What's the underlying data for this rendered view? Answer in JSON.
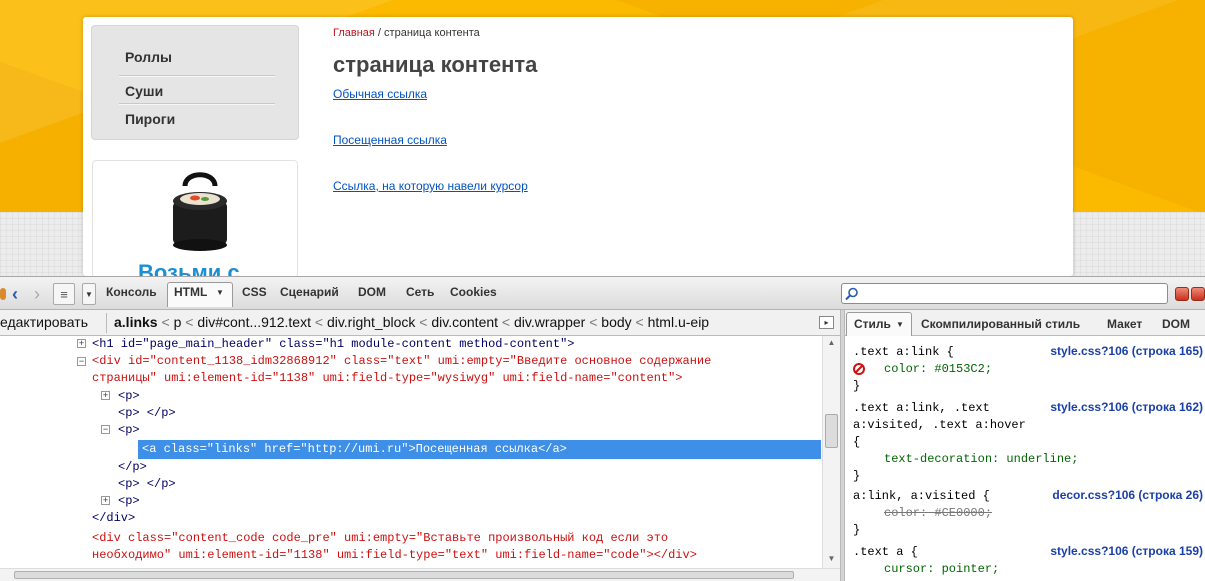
{
  "site": {
    "menu": [
      "Роллы",
      "Суши",
      "Пироги"
    ],
    "promo_text": "Возьми с",
    "breadcrumb": {
      "home": "Главная",
      "sep": " / ",
      "current": "страница контента"
    },
    "title": "страница контента",
    "links": [
      "Обычная ссылка",
      "Посещенная ссылка",
      "Ссылка, на которую навели курсор"
    ]
  },
  "devtools": {
    "tabs": [
      "Консоль",
      "HTML",
      "CSS",
      "Сценарий",
      "DOM",
      "Сеть",
      "Cookies"
    ],
    "edit_label": "едактировать",
    "crumbs": [
      "a.links",
      "p",
      "div#cont...912.text",
      "div.right_block",
      "div.content",
      "div.wrapper",
      "body",
      "html.u-eip"
    ],
    "side_tabs": [
      "Стиль",
      "Скомпилированный стиль",
      "Макет",
      "DOM"
    ],
    "html_lines": [
      "<h1 id=\"page_main_header\" class=\"h1 module-content method-content\">",
      "<div id=\"content_1138_idm32868912\" class=\"text\" umi:empty=\"Введите основное содержание",
      "страницы\" umi:element-id=\"1138\" umi:field-type=\"wysiwyg\" umi:field-name=\"content\">",
      "<p>",
      "<p>  </p>",
      "<p>",
      "<a class=\"links\" href=\"http://umi.ru\">Посещенная ссылка</a>",
      "</p>",
      "<p>  </p>",
      "<p>",
      "</div>",
      "<div class=\"content_code code_pre\" umi:empty=\"Вставьте произвольный код если это",
      "необходимо\" umi:element-id=\"1138\" umi:field-type=\"text\" umi:field-name=\"code\"></div>"
    ],
    "css_rules": [
      {
        "lines": [
          ".text a:link {",
          "color: #0153C2;",
          "}"
        ],
        "source": "style.css?106 (строка 165)"
      },
      {
        "lines": [
          ".text a:link, .text",
          "a:visited, .text a:hover",
          "{",
          "text-decoration: underline;",
          "}"
        ],
        "source": "style.css?106 (строка 162)"
      },
      {
        "lines": [
          "a:link, a:visited {",
          "color: #CE0000;",
          "}"
        ],
        "source": "decor.css?106 (строка 26)"
      },
      {
        "lines": [
          ".text a {",
          "cursor: pointer;"
        ],
        "source": "style.css?106 (строка 159)"
      }
    ],
    "colors": {
      "selection": "#3d8fe8",
      "link": "#0153C2"
    }
  }
}
